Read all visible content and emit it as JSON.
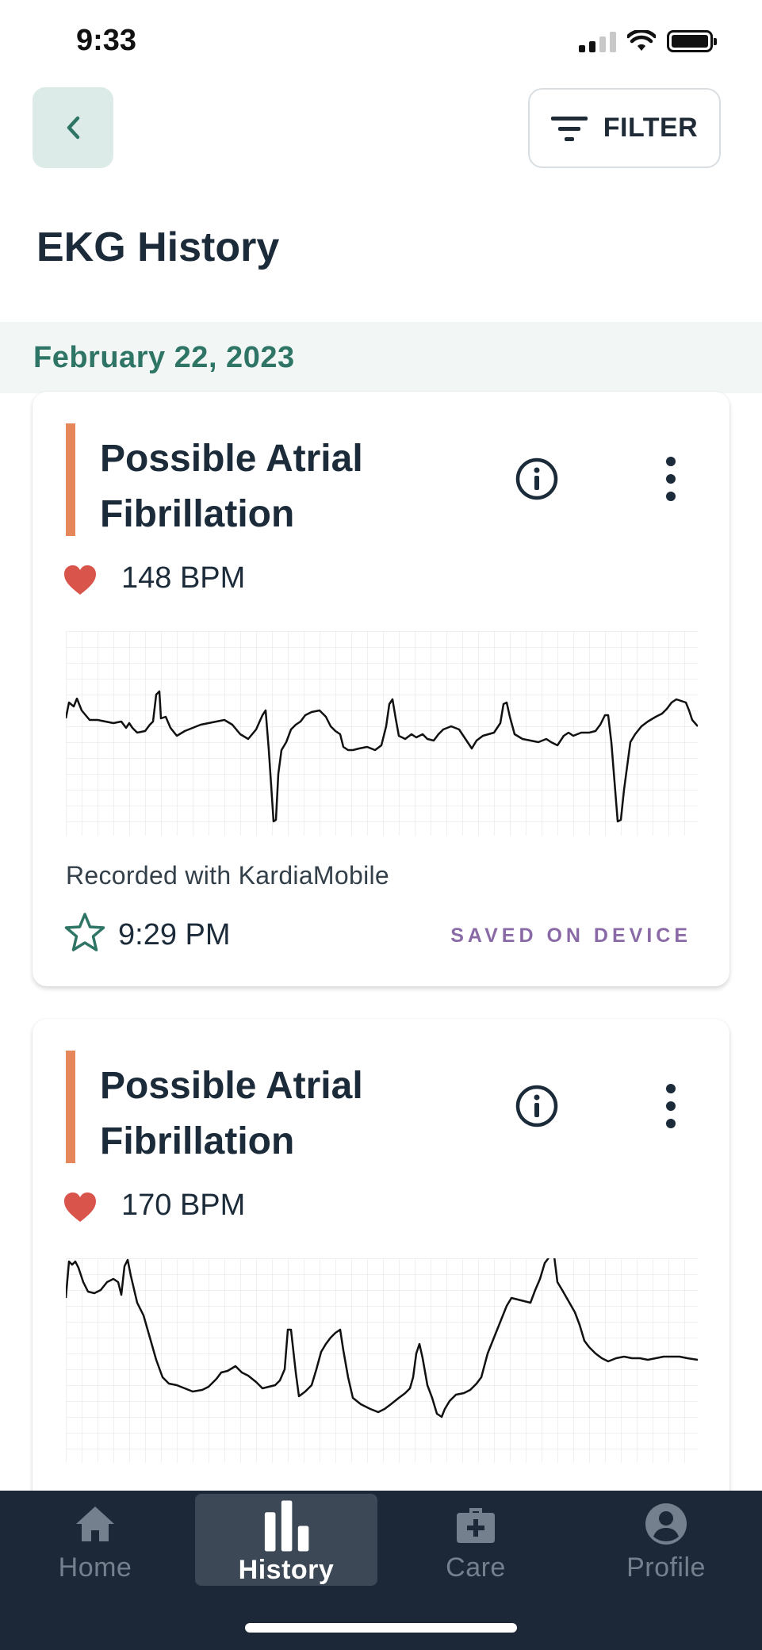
{
  "status": {
    "time": "9:33"
  },
  "header": {
    "filter_label": "FILTER",
    "title": "EKG History"
  },
  "date_group": {
    "label": "February 22, 2023"
  },
  "recordings": [
    {
      "title": "Possible Atrial Fibrillation",
      "bpm": "148 BPM",
      "recorded_with": "Recorded with KardiaMobile",
      "time": "9:29 PM",
      "saved": "SAVED ON DEVICE"
    },
    {
      "title": "Possible Atrial Fibrillation",
      "bpm": "170 BPM"
    }
  ],
  "tabs": [
    {
      "label": "Home",
      "icon": "home-icon"
    },
    {
      "label": "History",
      "icon": "bar-chart-icon",
      "active": true
    },
    {
      "label": "Care",
      "icon": "medical-bag-icon"
    },
    {
      "label": "Profile",
      "icon": "account-icon"
    }
  ],
  "colors": {
    "accent_afib": "#e5875a",
    "heart": "#d9544a",
    "date_green": "#2f7565",
    "saved_purple": "#8a6aa6",
    "tab_bar": "#1c2837"
  }
}
